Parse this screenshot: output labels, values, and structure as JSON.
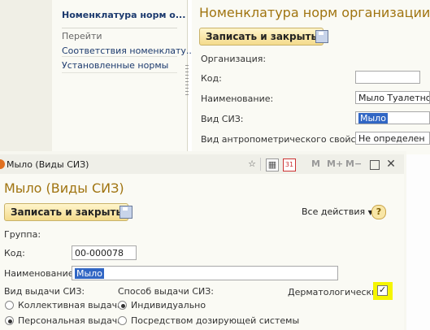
{
  "background_form": {
    "nav_title": "Номенклатура норм о...",
    "nav_goto": "Перейти",
    "nav_links": [
      "Соответствия номенклату...",
      "Установленные нормы"
    ],
    "title": "Номенклатура норм организации",
    "save_close": "Записать и закрыть",
    "labels": {
      "org": "Организация:",
      "code": "Код:",
      "name": "Наименование:",
      "siz_kind": "Вид СИЗ:",
      "anthro": "Вид антропометрического свойства:"
    },
    "values": {
      "code": "",
      "name": "Мыло Туалетное",
      "siz_kind": "Мыло",
      "anthro": "Не определен"
    }
  },
  "dialog": {
    "window_title": "Мыло (Виды СИЗ)",
    "toolbar_marks": [
      "M",
      "M+",
      "M−"
    ],
    "heading": "Мыло (Виды СИЗ)",
    "save_close": "Записать и закрыть",
    "all_actions": "Все действия",
    "help": "?",
    "group_label": "Группа:",
    "code_label": "Код:",
    "code_value": "00-000078",
    "name_label": "Наименование:",
    "name_value": "Мыло",
    "issue_kind_label": "Вид выдачи СИЗ:",
    "issue_kind_options": [
      "Коллективная выдача",
      "Персональная выдача"
    ],
    "issue_kind_selected": "Персональная выдача",
    "issue_method_label": "Способ выдачи СИЗ:",
    "issue_method_options": [
      "Индивидуально",
      "Посредством дозирующей системы"
    ],
    "issue_method_selected": "Индивидуально",
    "derm_label": "Дерматологический:",
    "derm_checked": true,
    "derm_checkmark": "✓"
  },
  "colors": {
    "heading": "#a07410",
    "link": "#1c3a6e",
    "selection": "#3166c4",
    "highlight": "#f5f500"
  }
}
